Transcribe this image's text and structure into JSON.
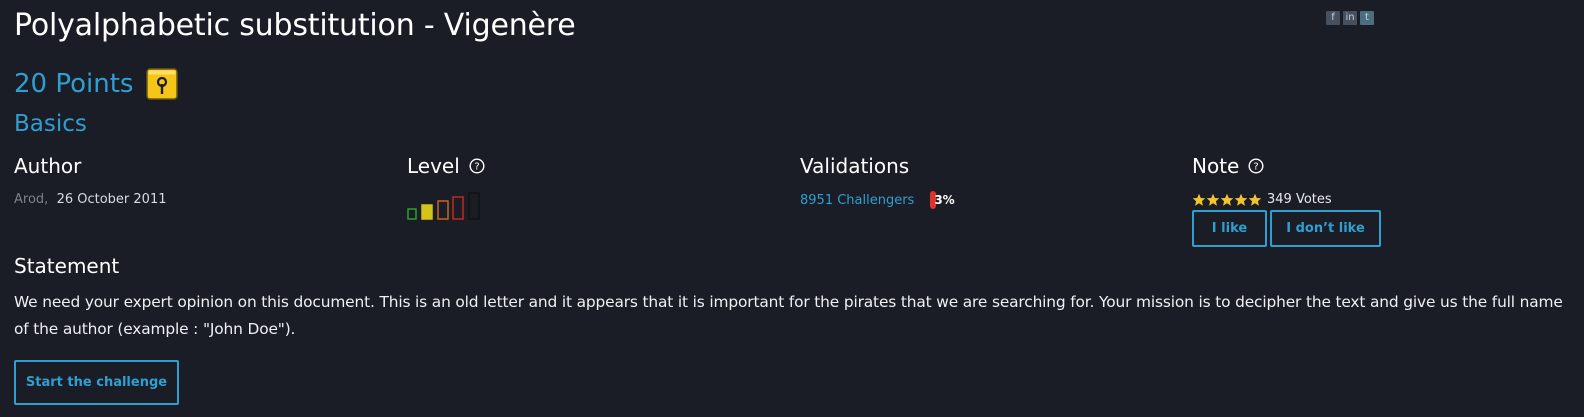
{
  "share": {
    "facebook_glyph": "f",
    "linkedin_glyph": "in",
    "twitter_glyph": "t"
  },
  "challenge": {
    "title": "Polyalphabetic substitution - Vigenère",
    "points": "20 Points",
    "category": "Basics"
  },
  "author": {
    "heading": "Author",
    "name": "Arod",
    "separator": ",",
    "date": "26 October 2011"
  },
  "level": {
    "heading": "Level",
    "value": 2,
    "max": 5
  },
  "validations": {
    "heading": "Validations",
    "challengers": "8951 Challengers",
    "percent": "3%"
  },
  "note": {
    "heading": "Note",
    "stars": 5,
    "votes": "349 Votes",
    "like_label": "I like",
    "dislike_label": "I don’t like"
  },
  "statement": {
    "heading": "Statement",
    "text": "We need your expert opinion on this document. This is an old letter and it appears that it is important for the pirates that we are searching for. Your mission is to decipher the text and give us the full name of the author (example : \"John Doe\")."
  },
  "actions": {
    "start_label": "Start the challenge"
  },
  "colors": {
    "background": "#1a1d25",
    "accent": "#2f9fd2",
    "level_colors": [
      "#2da02d",
      "#d4c41a",
      "#c8661e",
      "#bb2d21",
      "#111111"
    ],
    "star": "#f2c230",
    "percent_bar": "#e0322d"
  }
}
